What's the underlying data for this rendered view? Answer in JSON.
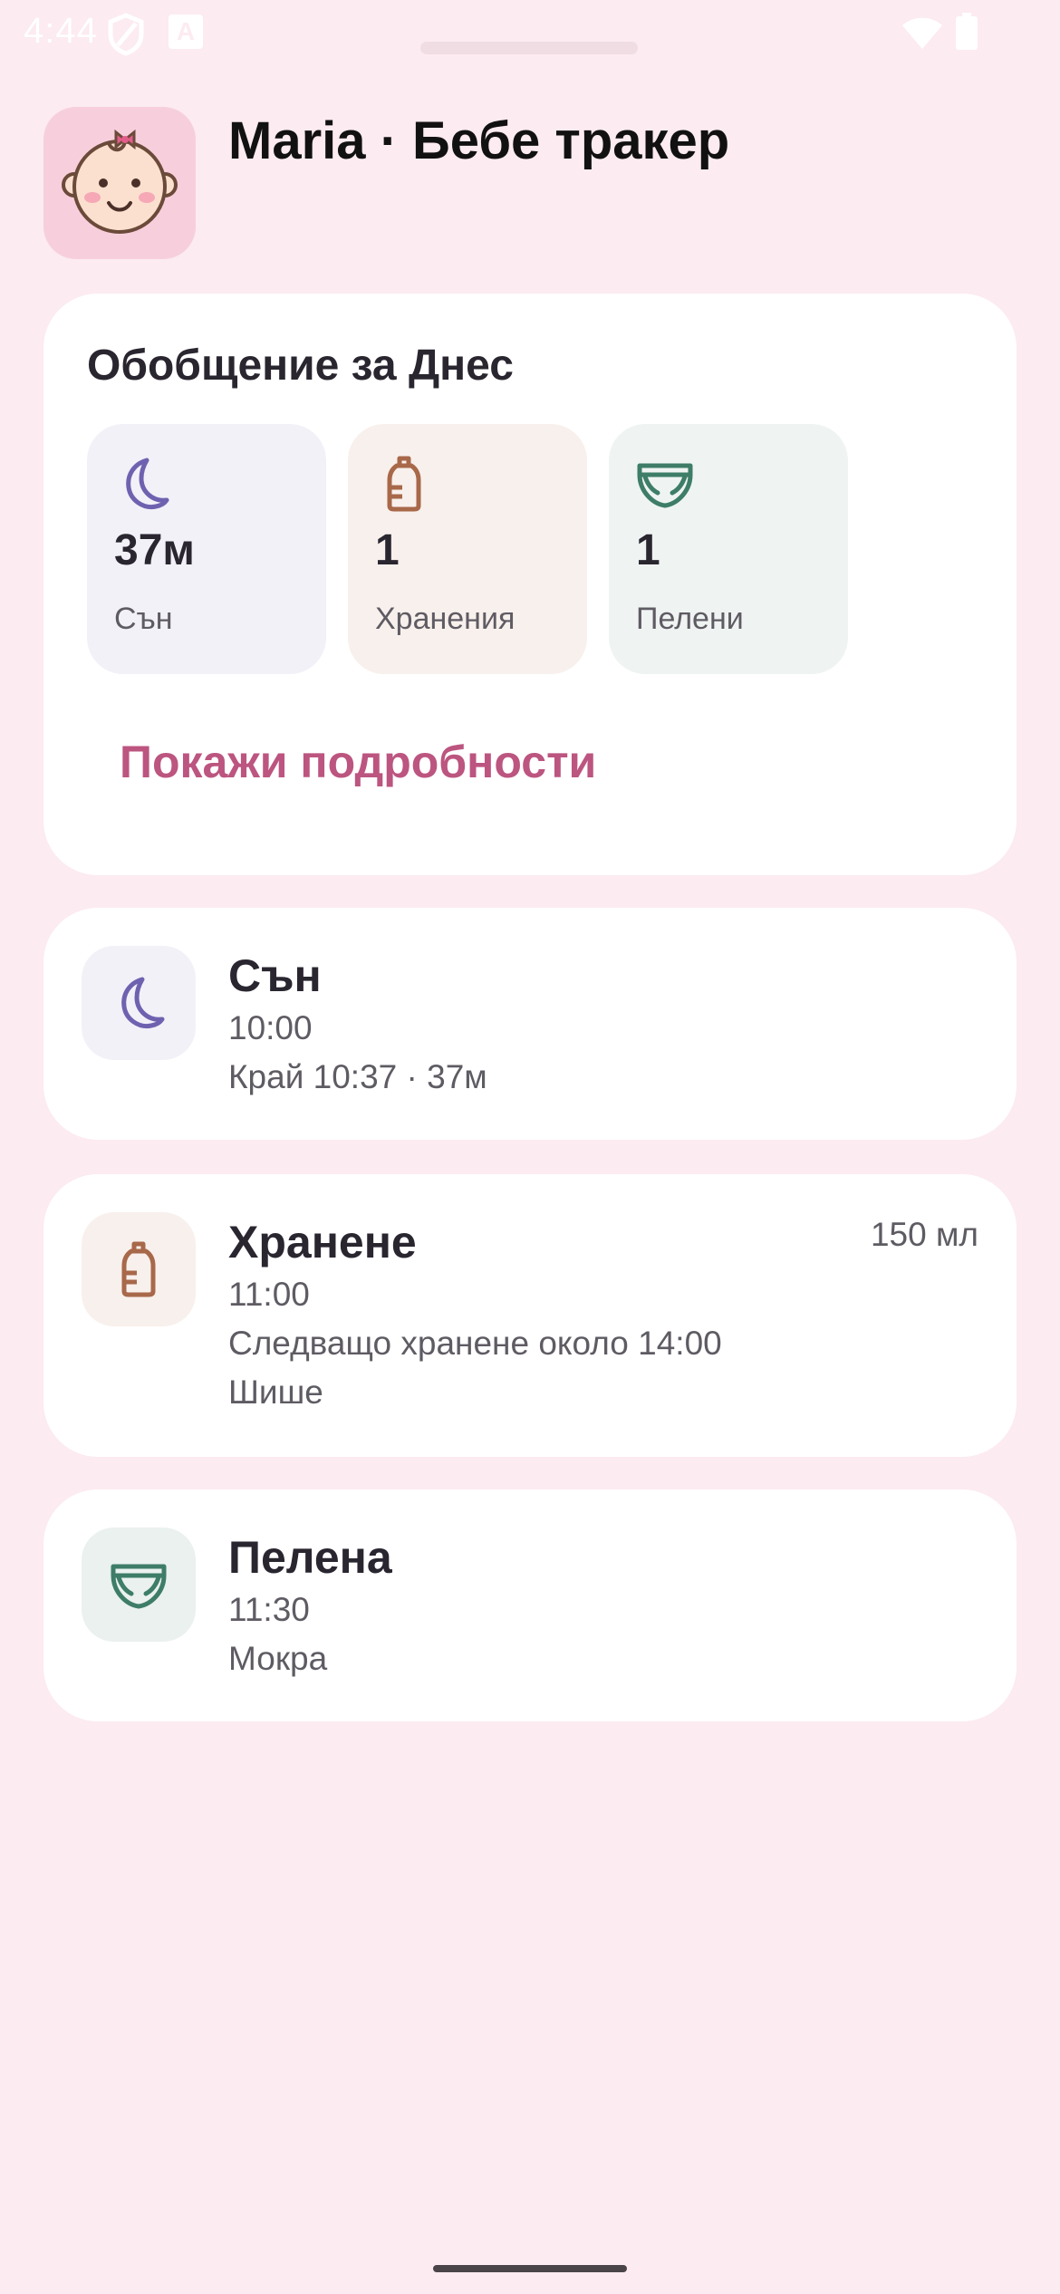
{
  "status_bar": {
    "time": "4:44",
    "icons": [
      "shield-icon",
      "a-icon",
      "wifi-icon",
      "battery-icon"
    ]
  },
  "header": {
    "title": "Maria · Бебе тракер",
    "avatar_icon": "baby-face-icon"
  },
  "summary": {
    "title": "Обобщение за Днес",
    "tiles": [
      {
        "icon": "moon-icon",
        "value": "37м",
        "label": "Сън",
        "color": "#6e62b0"
      },
      {
        "icon": "bottle-icon",
        "value": "1",
        "label": "Хранения",
        "color": "#a8684a"
      },
      {
        "icon": "diaper-icon",
        "value": "1",
        "label": "Пелени",
        "color": "#3e7d68"
      }
    ],
    "details_link": "Покажи подробности"
  },
  "events": [
    {
      "icon": "moon-icon",
      "title": "Сън",
      "time": "10:00",
      "detail": "Край 10:37 · 37м"
    },
    {
      "icon": "bottle-icon",
      "title": "Хранене",
      "amount": "150 мл",
      "time": "11:00",
      "detail": "Следващо хранене около 14:00",
      "detail2": "Шише"
    },
    {
      "icon": "diaper-icon",
      "title": "Пелена",
      "time": "11:30",
      "detail": "Мокра"
    }
  ],
  "colors": {
    "background": "#fcebf0",
    "accent": "#bc5580",
    "sleep": "#6e62b0",
    "feeding": "#a8684a",
    "diaper": "#3e7d68"
  }
}
